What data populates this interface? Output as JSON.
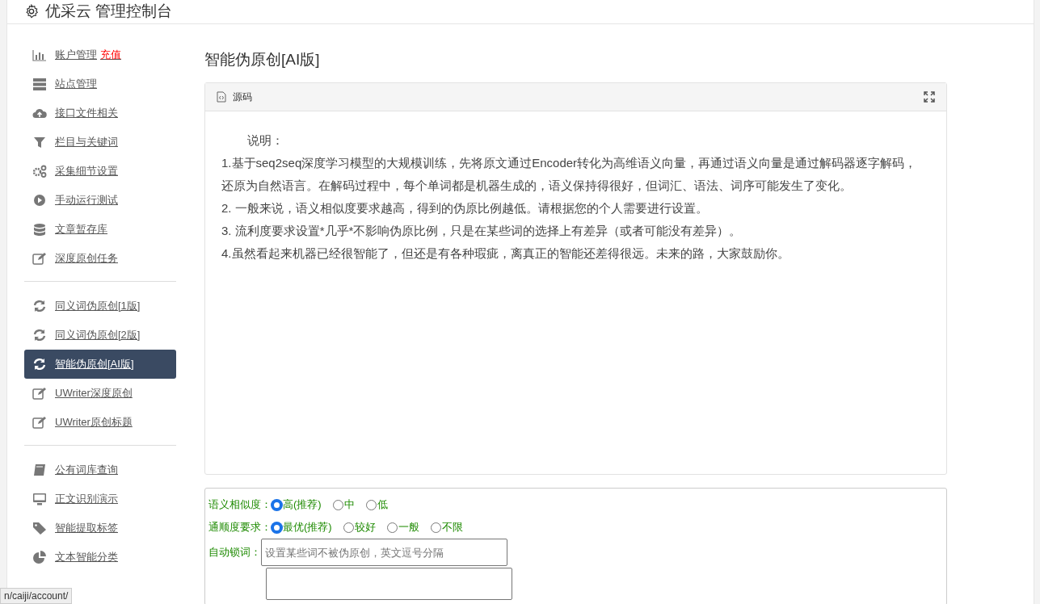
{
  "header": {
    "title": "优采云 管理控制台"
  },
  "sidebar": {
    "groups": [
      [
        {
          "label": "账户管理",
          "badge": "充值",
          "selected": false
        },
        {
          "label": "站点管理",
          "selected": false
        },
        {
          "label": "接口文件相关",
          "selected": false
        },
        {
          "label": "栏目与关键词",
          "selected": false
        },
        {
          "label": "采集细节设置",
          "selected": false
        },
        {
          "label": "手动运行测试",
          "selected": false
        },
        {
          "label": "文章暂存库",
          "selected": false
        },
        {
          "label": "深度原创任务",
          "selected": false
        }
      ],
      [
        {
          "label": "同义词伪原创[1版]",
          "selected": false
        },
        {
          "label": "同义词伪原创[2版]",
          "selected": false
        },
        {
          "label": "智能伪原创[AI版]",
          "selected": true
        },
        {
          "label": "UWriter深度原创",
          "selected": false
        },
        {
          "label": "UWriter原创标题",
          "selected": false
        }
      ],
      [
        {
          "label": "公有词库查询",
          "selected": false
        },
        {
          "label": "正文识别演示",
          "selected": false
        },
        {
          "label": "智能提取标签",
          "selected": false
        },
        {
          "label": "文本智能分类",
          "selected": false
        }
      ]
    ]
  },
  "page_title": "智能伪原创[AI版]",
  "source_card": {
    "title": "源码",
    "heading": "说明：",
    "lines": [
      "1.基于seq2seq深度学习模型的大规模训练，先将原文通过Encoder转化为高维语义向量，再通过语义向量是通过解码器逐字解码，还原为自然语言。在解码过程中，每个单词都是机器生成的，语义保持得很好，但词汇、语法、词序可能发生了变化。",
      "2. 一般来说，语义相似度要求越高，得到的伪原比例越低。请根据您的个人需要进行设置。",
      "3. 流利度要求设置*几乎*不影响伪原比例，只是在某些词的选择上有差异（或者可能没有差异）。",
      "4.虽然看起来机器已经很智能了，但还是有各种瑕疵，离真正的智能还差得很远。未来的路，大家鼓励你。"
    ]
  },
  "options_form": {
    "rows": [
      {
        "kind": "radio",
        "label": "语义相似度：",
        "options": [
          {
            "label": "高(推荐)",
            "selected": true
          },
          {
            "label": "中",
            "selected": false
          },
          {
            "label": "低",
            "selected": false
          }
        ]
      },
      {
        "kind": "radio",
        "label": "通顺度要求：",
        "options": [
          {
            "label": "最优(推荐)",
            "selected": true
          },
          {
            "label": "较好",
            "selected": false
          },
          {
            "label": "一般",
            "selected": false
          },
          {
            "label": "不限",
            "selected": false
          }
        ]
      },
      {
        "kind": "text",
        "label": "自动锁词：",
        "placeholder": "设置某些词不被伪原创，英文逗号分隔"
      },
      {
        "kind": "textarea"
      }
    ]
  },
  "status_url": "n/caiji/account/"
}
